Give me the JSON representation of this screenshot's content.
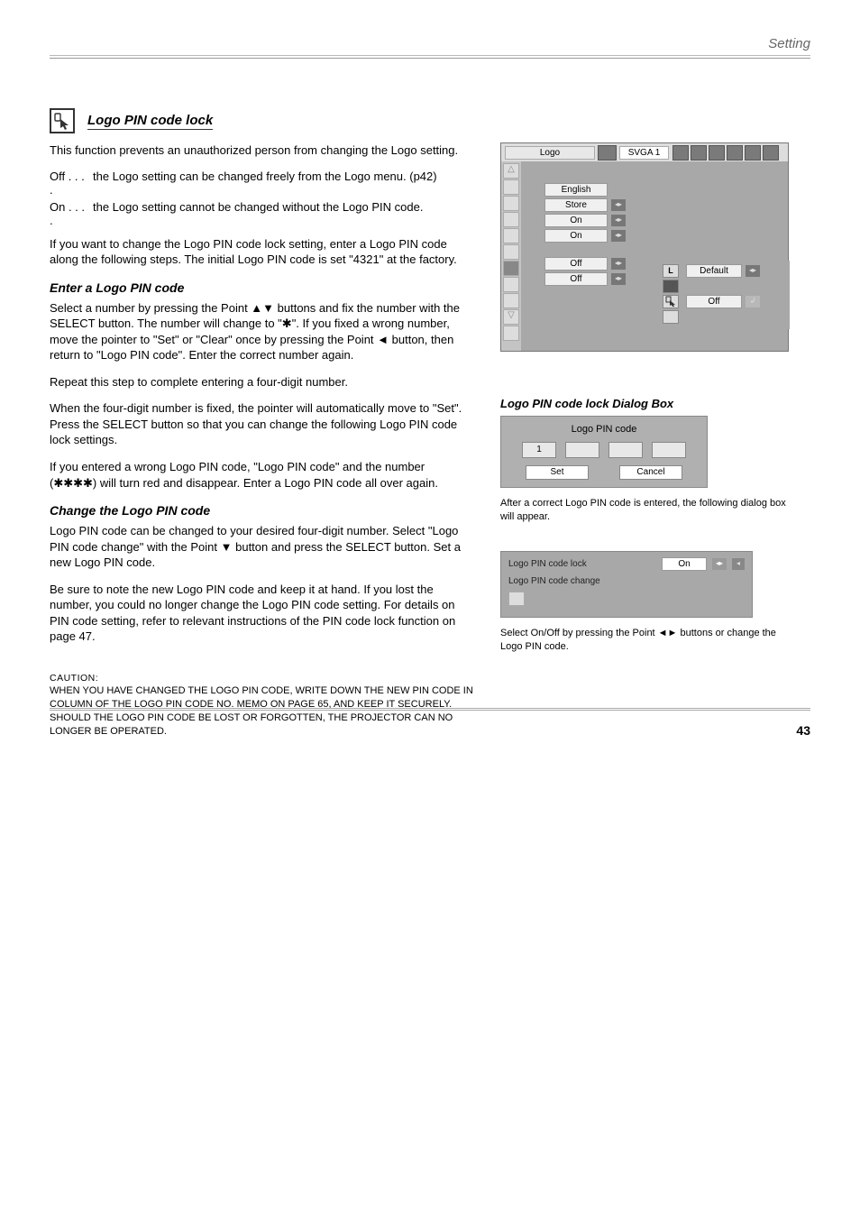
{
  "header": {
    "title": "Setting"
  },
  "section": {
    "icon_name": "lock-cursor-icon",
    "title": "Logo PIN code lock"
  },
  "para": {
    "intro": "This function prevents an unauthorized person from changing the Logo setting.",
    "off_label": "Off",
    "off_text": "the Logo setting can be changed freely from the Logo menu. (p42)",
    "on_label": "On",
    "on_text": "the Logo setting cannot be changed without the Logo PIN code.",
    "change_instruction": "If you want to change the Logo PIN code lock setting, enter a Logo PIN code along the following steps. The initial Logo PIN code is set \"4321\" at the factory."
  },
  "enter_heading": "Enter a Logo PIN code",
  "enter_text1a": "Select a number by pressing the Point ",
  "enter_text1b": " buttons and fix the number with the SELECT button. The number will change to \"",
  "enter_text1c": "\". If you fixed a wrong number, move the pointer to \"Set\" or \"Clear\" once by pressing the Point ",
  "enter_text1d": " button, then return to \"Logo PIN code\". Enter the correct number again.",
  "enter_text2": "Repeat this step to complete entering a four-digit number.",
  "enter_text3a": "When the four-digit number is fixed, the pointer will automatically move to \"Set\". Press the SELECT button so that you can change the following Logo PIN code lock settings.",
  "enter_text4a": "If you entered a wrong Logo PIN code, \"Logo PIN code\" and the number (",
  "enter_text4b": ") will turn red and disappear. Enter a Logo PIN code all over again.",
  "change_heading": "Change the Logo PIN code",
  "change_text1a": "Logo PIN code can be changed to your desired four-digit number. Select \"Logo PIN code change\" with the Point ",
  "change_text1b": " button and press the SELECT button. Set a new Logo PIN code.",
  "change_text2": "Be sure to note the new Logo PIN code and keep it at hand. If you lost the number, you could no longer change the Logo PIN code setting. For details on PIN code setting, refer to relevant instructions of the PIN code lock function on page 47.",
  "caution": {
    "title": "CAUTION:",
    "text": "WHEN YOU HAVE CHANGED THE LOGO PIN CODE, WRITE DOWN THE NEW PIN CODE IN COLUMN OF THE LOGO PIN CODE NO. MEMO ON PAGE 65, AND KEEP IT SECURELY. SHOULD THE LOGO PIN CODE BE LOST OR FORGOTTEN, THE PROJECTOR CAN NO LONGER BE OPERATED."
  },
  "logo_panel": {
    "title": "Logo",
    "mode": "SVGA 1",
    "rows": {
      "language": "English",
      "store": "Store",
      "on1": "On",
      "on2": "On",
      "off1": "Off",
      "off2": "Off"
    },
    "popup": {
      "l_label": "L",
      "default_val": "Default",
      "pin_icon": "",
      "off_val": "Off"
    }
  },
  "pin_dialog_fig": {
    "label": "Logo PIN code lock Dialog Box",
    "title": "Logo PIN code",
    "val1": "1",
    "set_label": "Set",
    "cancel_label": "Cancel",
    "note": "After a correct Logo PIN code is entered, the following dialog box will appear."
  },
  "pin_lock_panel": {
    "row1_label": "Logo PIN code lock",
    "row1_value": "On",
    "row2_label": "Logo PIN code change",
    "note_a": "Select On/Off by pressing the Point ",
    "note_b": " buttons or change the Logo PIN code."
  },
  "ast1": "✱",
  "ast4": "✱✱✱✱",
  "page_number": "43"
}
